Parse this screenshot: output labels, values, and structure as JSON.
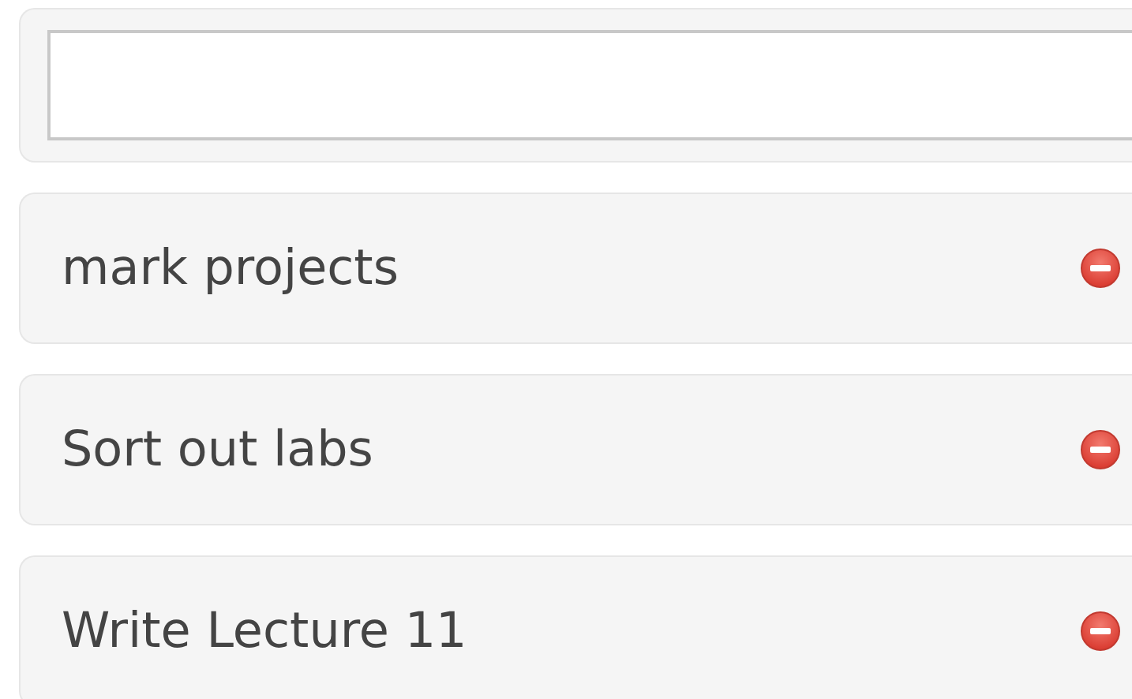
{
  "tasks": [
    {
      "label": "mark projects"
    },
    {
      "label": "Sort out labs"
    },
    {
      "label": "Write Lecture 11"
    }
  ]
}
